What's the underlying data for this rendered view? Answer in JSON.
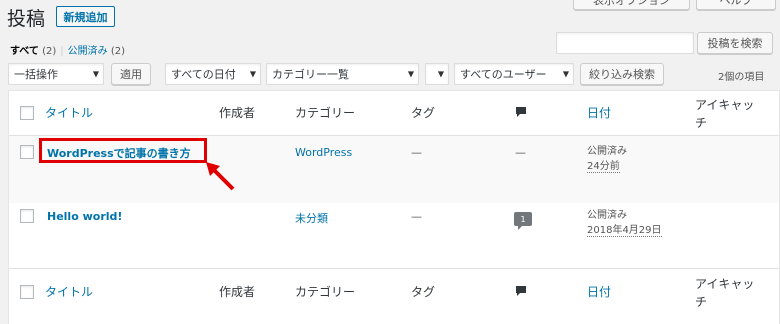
{
  "header": {
    "title": "投稿",
    "add_new_label": "新規追加",
    "screen_options_label": "表示オプション",
    "help_label": "ヘルプ"
  },
  "views": {
    "all_label": "すべて",
    "all_count": "(2)",
    "separator": "|",
    "published_label": "公開済み",
    "published_count": "(2)"
  },
  "search": {
    "value": "",
    "button_label": "投稿を検索"
  },
  "filters": {
    "bulk_action": "一括操作",
    "apply_label": "適用",
    "date_filter": "すべての日付",
    "category_filter": "カテゴリー一覧",
    "format_filter": "",
    "user_filter": "すべてのユーザー",
    "filter_button_label": "絞り込み検索",
    "items_count": "2個の項目"
  },
  "columns": {
    "title": "タイトル",
    "author": "作成者",
    "categories": "カテゴリー",
    "tags": "タグ",
    "date": "日付",
    "featured": "アイキャッチ"
  },
  "posts": [
    {
      "title": "WordPressで記事の書き方",
      "author": "",
      "category": "WordPress",
      "tags": "—",
      "comments": "—",
      "date_status": "公開済み",
      "date_value": "24分前"
    },
    {
      "title": "Hello world!",
      "author": "",
      "category": "未分類",
      "tags": "—",
      "comments": "1",
      "date_status": "公開済み",
      "date_value": "2018年4月29日"
    }
  ],
  "colors": {
    "link": "#0073aa",
    "highlight": "#e00000",
    "background": "#f1f1f1"
  }
}
